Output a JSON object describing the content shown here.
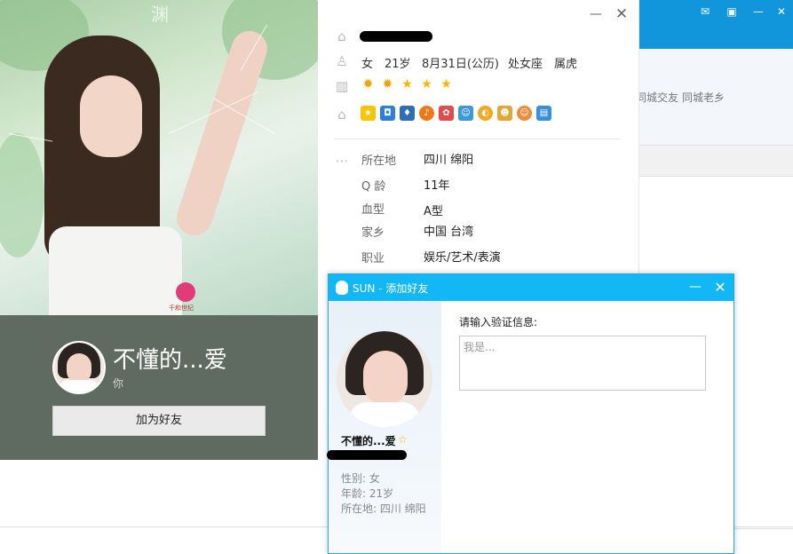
{
  "background_window": {
    "links": [
      "同城交友",
      "同城老乡"
    ]
  },
  "photo_panel": {
    "watermark_text": "渊",
    "logo_text": "千和世纪"
  },
  "card": {
    "nickname": "不懂的...爱",
    "subtitle": "你",
    "add_button": "加为好友"
  },
  "info": {
    "gender": "女",
    "age": "21岁",
    "birthday": "8月31日(公历)",
    "zodiac": "处女座",
    "chinese_zodiac": "属虎",
    "level_icons": [
      "sun-icon",
      "sun-icon",
      "star-icon",
      "star-icon",
      "star-icon"
    ],
    "badge_icons": [
      "vip-star-icon",
      "photo-icon",
      "shield-icon",
      "music-icon",
      "game-icon",
      "pet-icon",
      "mail-icon",
      "tiger-icon",
      "face-icon",
      "id-icon"
    ],
    "rows": [
      {
        "label": "所在地",
        "value": "四川 绵阳"
      },
      {
        "label": "Q 龄",
        "value": "11年"
      },
      {
        "label": "血型",
        "value": "A型"
      },
      {
        "label": "家乡",
        "value": "中国 台湾"
      },
      {
        "label": "职业",
        "value": "娱乐/艺术/表演"
      }
    ]
  },
  "dialog": {
    "title": "SUN - 添加好友",
    "name": "不懂的...爱",
    "gender_line": "性别: 女",
    "age_line": "年龄: 21岁",
    "location_line": "所在地: 四川  绵阳",
    "prompt": "请输入验证信息:",
    "verify_placeholder": "我是..."
  },
  "colors": {
    "title_blue": "#12b7f5",
    "card_bg": "#5f6b61",
    "main_blue": "#1296db"
  }
}
